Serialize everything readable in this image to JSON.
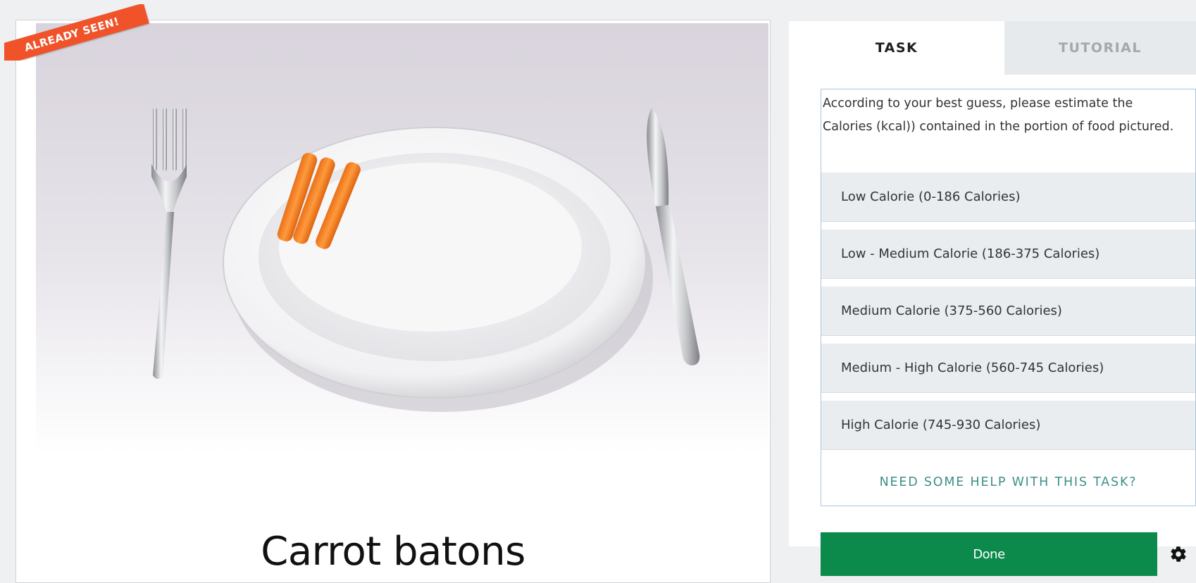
{
  "subject": {
    "caption": "Carrot batons",
    "banner_label": "ALREADY SEEN!"
  },
  "tabs": [
    {
      "label": "TASK",
      "active": true
    },
    {
      "label": "TUTORIAL",
      "active": false
    }
  ],
  "task": {
    "instructions": "According to your best guess, please estimate the Calories (kcal)) contained in the portion of food pictured.",
    "answers": [
      {
        "label": "Low Calorie (0-186 Calories)"
      },
      {
        "label": "Low - Medium Calorie (186-375 Calories)"
      },
      {
        "label": "Medium Calorie (375-560 Calories)"
      },
      {
        "label": "Medium - High Calorie (560-745 Calories)"
      },
      {
        "label": "High Calorie (745-930 Calories)"
      }
    ],
    "help_link": "NEED SOME HELP WITH THIS TASK?",
    "done_label": "Done"
  },
  "colors": {
    "banner": "#f0532a",
    "done_button": "#0b8a4c",
    "help_link": "#3d8f88",
    "task_box_border": "#a9c5de"
  },
  "icons": {
    "settings": "gear-icon"
  }
}
